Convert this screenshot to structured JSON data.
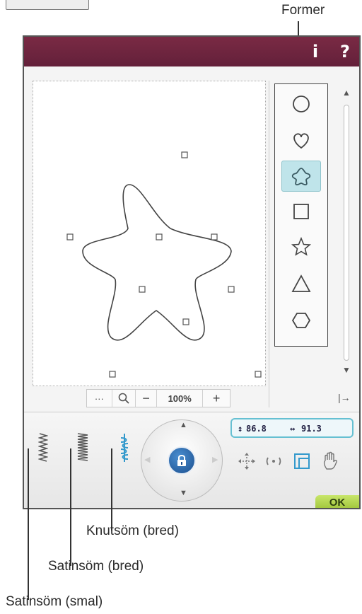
{
  "labels": {
    "former": "Former",
    "knutsom": "Knutsöm (bred)",
    "satin_bred": "Satinsöm (bred)",
    "satin_smal": "Satinsöm (smal)"
  },
  "titlebar": {
    "info_label": "i",
    "help_label": "?"
  },
  "shapes": [
    {
      "name": "circle-icon"
    },
    {
      "name": "heart-icon"
    },
    {
      "name": "flower-icon",
      "selected": true
    },
    {
      "name": "square-icon"
    },
    {
      "name": "star-icon"
    },
    {
      "name": "triangle-icon"
    },
    {
      "name": "hexagon-icon"
    }
  ],
  "zoom": {
    "more_label": "···",
    "minus_label": "−",
    "value": "100%",
    "plus_label": "+"
  },
  "readout": {
    "height_icon": "↕",
    "height": "86.8",
    "width_icon": "↔",
    "width": "91.3"
  },
  "ok_label": "OK",
  "colors": {
    "titlebar": "#6e2640",
    "accent": "#66c0d2",
    "ok": "#9cc236",
    "knut_stitch": "#3399cc"
  }
}
